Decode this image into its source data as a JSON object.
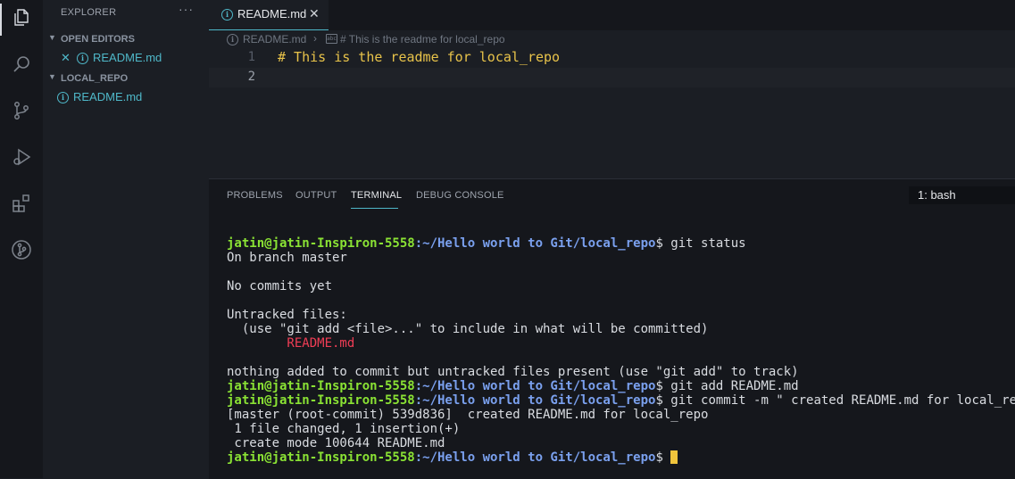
{
  "sidebar": {
    "title": "EXPLORER",
    "more": "···",
    "open_editors": {
      "label": "OPEN EDITORS",
      "items": [
        {
          "label": "README.md"
        }
      ]
    },
    "folder": {
      "label": "LOCAL_REPO",
      "items": [
        {
          "label": "README.md"
        }
      ]
    }
  },
  "editor": {
    "tab": {
      "label": "README.md",
      "close": "✕"
    },
    "breadcrumb": {
      "file": "README.md",
      "sep": "›",
      "symbol": "# This is the readme for local_repo"
    },
    "lines": [
      {
        "num": "1",
        "text": "# This is the readme for local_repo"
      },
      {
        "num": "2",
        "text": ""
      }
    ]
  },
  "panel": {
    "tabs": [
      "PROBLEMS",
      "OUTPUT",
      "TERMINAL",
      "DEBUG CONSOLE"
    ],
    "active_tab": "TERMINAL",
    "terminal_select": "1: bash"
  },
  "terminal": {
    "prompt_user": "jatin@jatin-Inspiron-5558",
    "prompt_path": ":~/Hello world to Git/local_repo",
    "prompt_suffix": "$ ",
    "lines": {
      "cmd1": "git status",
      "o1": "On branch master",
      "o2": "No commits yet",
      "o3": "Untracked files:",
      "o4": "  (use \"git add <file>...\" to include in what will be committed)",
      "o5": "        README.md",
      "o6": "nothing added to commit but untracked files present (use \"git add\" to track)",
      "cmd2": "git add README.md",
      "cmd3": "git commit -m \" created README.md for local_repo\"",
      "o7": "[master (root-commit) 539d836]  created README.md for local_repo",
      "o8": " 1 file changed, 1 insertion(+)",
      "o9": " create mode 100644 README.md"
    }
  },
  "colors": {
    "accent": "#4fb8c9",
    "prompt_user": "#8ae234",
    "prompt_path": "#7aa0ee",
    "untracked": "#f03d55",
    "heading": "#e8c34a",
    "cursor": "#f0c43c"
  },
  "icons": [
    "files-icon",
    "search-icon",
    "source-control-icon",
    "run-debug-icon",
    "extensions-icon",
    "git-graph-icon"
  ]
}
